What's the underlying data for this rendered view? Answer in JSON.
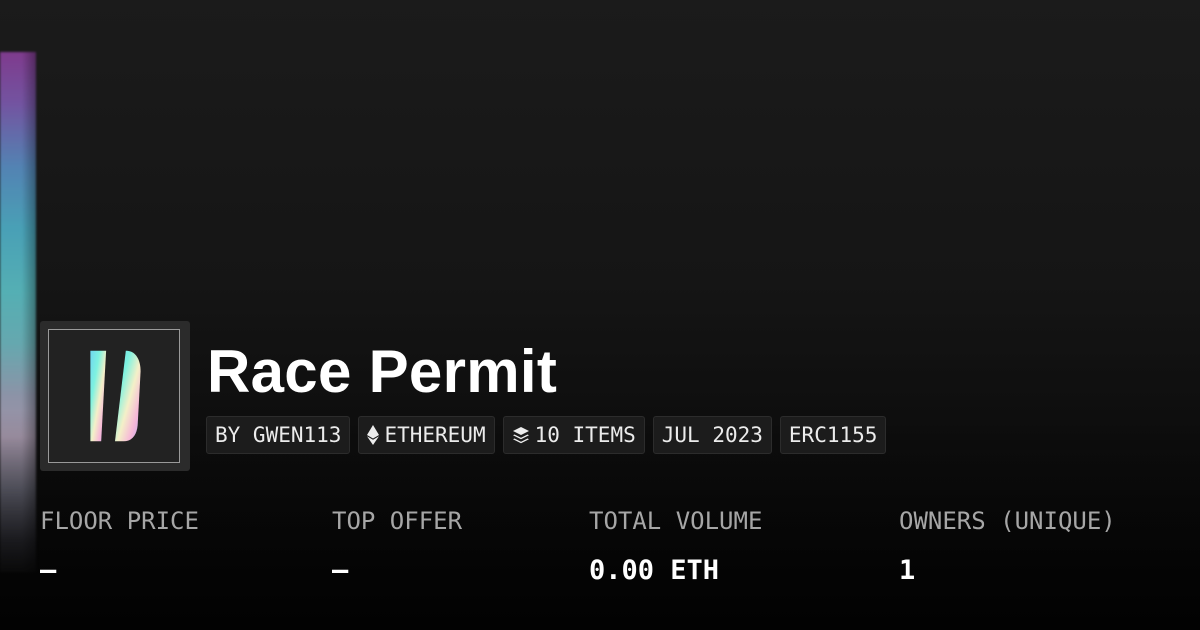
{
  "collection": {
    "title": "Race Permit",
    "tags": {
      "creator": "BY GWEN113",
      "chain": "ETHEREUM",
      "items": "10 ITEMS",
      "date": "JUL 2023",
      "standard": "ERC1155"
    },
    "icons": {
      "chain": "ethereum-icon",
      "items": "layers-icon"
    }
  },
  "stats": {
    "floor_price": {
      "label": "FLOOR PRICE",
      "value": "–"
    },
    "top_offer": {
      "label": "TOP OFFER",
      "value": "–"
    },
    "total_volume": {
      "label": "TOTAL VOLUME",
      "value": "0.00 ETH"
    },
    "owners": {
      "label": "OWNERS (UNIQUE)",
      "value": "1"
    }
  },
  "colors": {
    "background": "#141414",
    "text_primary": "#ffffff",
    "text_muted": "#a6a6a6",
    "tag_background": "#1c1c1c"
  }
}
